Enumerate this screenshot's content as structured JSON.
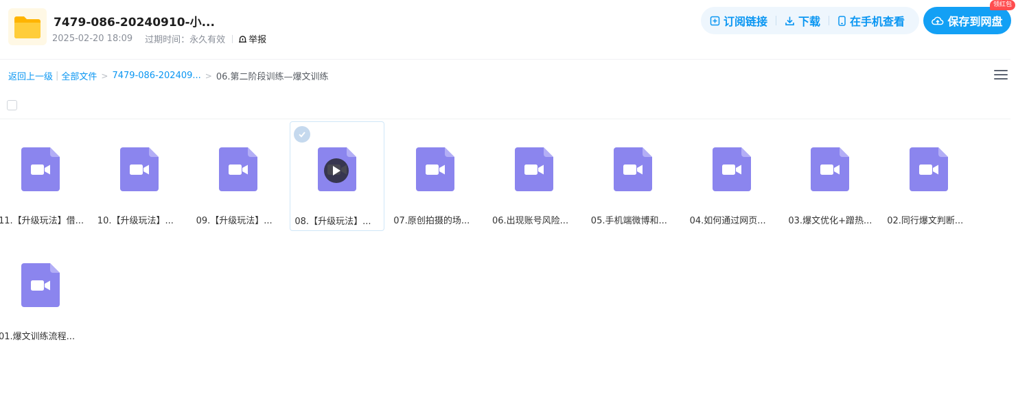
{
  "header": {
    "title": "7479-086-20240910-小...",
    "date": "2025-02-20 18:09",
    "expire": "过期时间：永久有效",
    "report_label": "举报",
    "actions": {
      "subscribe": "订阅链接",
      "download": "下载",
      "view_on_phone": "在手机查看",
      "save": "保存到网盘",
      "badge": "领红包"
    }
  },
  "breadcrumb": {
    "back": "返回上一级",
    "all_files": "全部文件",
    "parent": "7479-086-202409...",
    "current": "06.第二阶段训练—爆文训练"
  },
  "colors": {
    "accent": "#0a96f2",
    "save_button": "#13a0f5",
    "badge": "#ff4d4f",
    "video_icon": "#8b85ee",
    "folder_icon": "#ffc62b"
  },
  "files": [
    {
      "name": "11.【升级玩法】借...",
      "icon": "video-file-icon",
      "selected": false
    },
    {
      "name": "10.【升级玩法】...",
      "icon": "video-file-icon",
      "selected": false
    },
    {
      "name": "09.【升级玩法】...",
      "icon": "video-file-icon",
      "selected": false
    },
    {
      "name": "08.【升级玩法】...",
      "icon": "video-file-icon",
      "selected": true
    },
    {
      "name": "07.原创拍摄的场...",
      "icon": "video-file-icon",
      "selected": false
    },
    {
      "name": "06.出现账号风险...",
      "icon": "video-file-icon",
      "selected": false
    },
    {
      "name": "05.手机端微博和...",
      "icon": "video-file-icon",
      "selected": false
    },
    {
      "name": "04.如何通过网页...",
      "icon": "video-file-icon",
      "selected": false
    },
    {
      "name": "03.爆文优化+蹭热...",
      "icon": "video-file-icon",
      "selected": false
    },
    {
      "name": "02.同行爆文判断...",
      "icon": "video-file-icon",
      "selected": false
    },
    {
      "name": "01.爆文训练流程...",
      "icon": "video-file-icon",
      "selected": false
    }
  ]
}
